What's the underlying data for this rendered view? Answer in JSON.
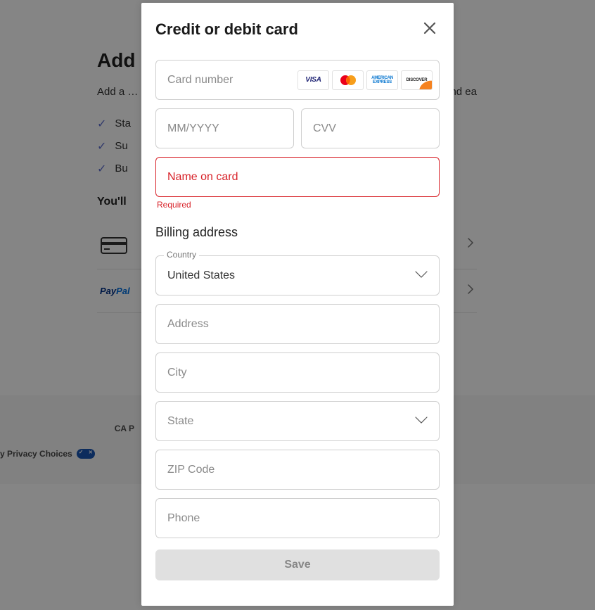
{
  "background": {
    "page_title_prefix": "Add",
    "subtitle_pre": "Add a",
    "subtitle_post": "kly and ea",
    "benefits": [
      "Sta",
      "Su",
      "Bu"
    ],
    "choose_title_prefix": "You'll",
    "paypal_label": "PayPal"
  },
  "footer": {
    "privacy_choices": "y Privacy Choices",
    "ca_notice": "CA P"
  },
  "modal": {
    "title": "Credit or debit card",
    "fields": {
      "card_number": {
        "placeholder": "Card number"
      },
      "expiry": {
        "placeholder": "MM/YYYY"
      },
      "cvv": {
        "placeholder": "CVV"
      },
      "name": {
        "placeholder": "Name on card",
        "error": "Required"
      },
      "address": {
        "placeholder": "Address"
      },
      "city": {
        "placeholder": "City"
      },
      "state": {
        "placeholder": "State"
      },
      "zip": {
        "placeholder": "ZIP Code"
      },
      "phone": {
        "placeholder": "Phone"
      }
    },
    "billing_section": "Billing address",
    "country": {
      "label": "Country",
      "value": "United States"
    },
    "save_button": "Save",
    "card_brands": {
      "visa": "VISA",
      "amex_line1": "AMERICAN",
      "amex_line2": "EXPRESS",
      "discover": "DISCOVER"
    }
  }
}
